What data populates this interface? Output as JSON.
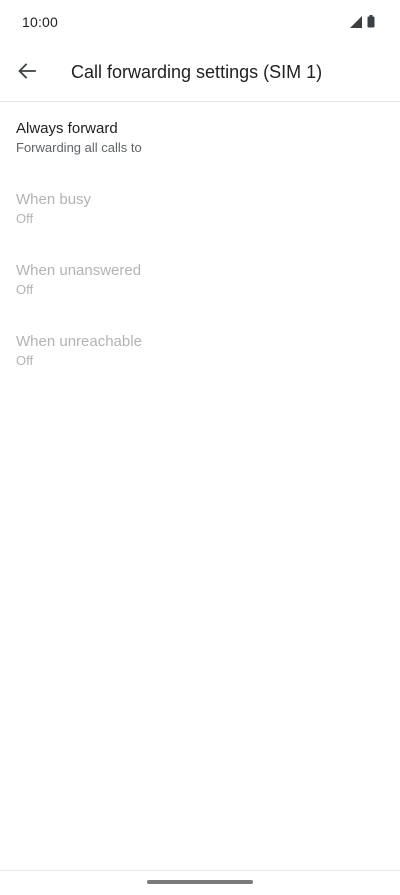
{
  "status_bar": {
    "time": "10:00",
    "icons": [
      "signal-icon",
      "battery-icon"
    ]
  },
  "toolbar": {
    "back_icon": "arrow-back-icon",
    "title": "Call forwarding settings (SIM 1)"
  },
  "preferences": [
    {
      "title": "Always forward",
      "summary": "Forwarding all calls to",
      "enabled": true
    },
    {
      "title": "When busy",
      "summary": "Off",
      "enabled": false
    },
    {
      "title": "When unanswered",
      "summary": "Off",
      "enabled": false
    },
    {
      "title": "When unreachable",
      "summary": "Off",
      "enabled": false
    }
  ],
  "colors": {
    "text_primary": "#202124",
    "text_secondary": "#5f6368",
    "text_disabled": "#b3b3b3",
    "divider": "#e4e4e4"
  }
}
